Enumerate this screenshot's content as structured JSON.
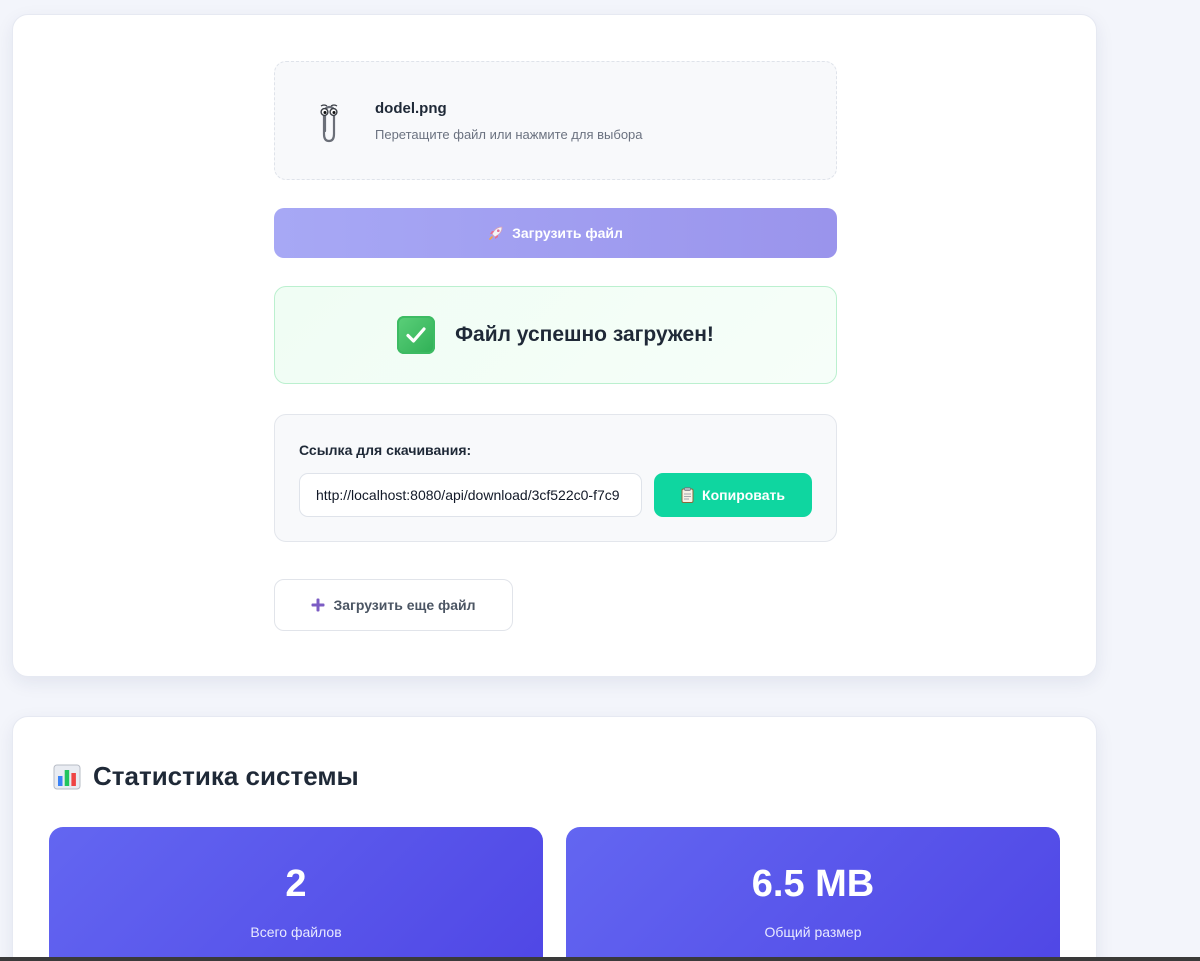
{
  "upload": {
    "file_name": "dodel.png",
    "hint": "Перетащите файл или нажмите для выбора",
    "upload_button": "Загрузить файл",
    "success_message": "Файл успешно загружен!",
    "link_label": "Ссылка для скачивания:",
    "link_value": "http://localhost:8080/api/download/3cf522c0-f7c9",
    "copy_button": "Копировать",
    "again_button": "Загрузить еще файл"
  },
  "icons": {
    "clip": "paperclip-icon",
    "rocket": "rocket-icon",
    "success": "check-mark-icon",
    "copy": "clipboard-icon",
    "again": "plus-icon",
    "stats": "bar-chart-icon"
  },
  "stats": {
    "title": "Статистика системы",
    "cards": [
      {
        "value": "2",
        "label": "Всего файлов"
      },
      {
        "value": "6.5 MB",
        "label": "Общий размер"
      }
    ]
  },
  "colors": {
    "accent": "#6366f1",
    "upload_button": "#a09ef2",
    "copy_button": "#0fd6a0",
    "success_bg": "#f0fdf4",
    "success_border": "#bbf0cf"
  }
}
